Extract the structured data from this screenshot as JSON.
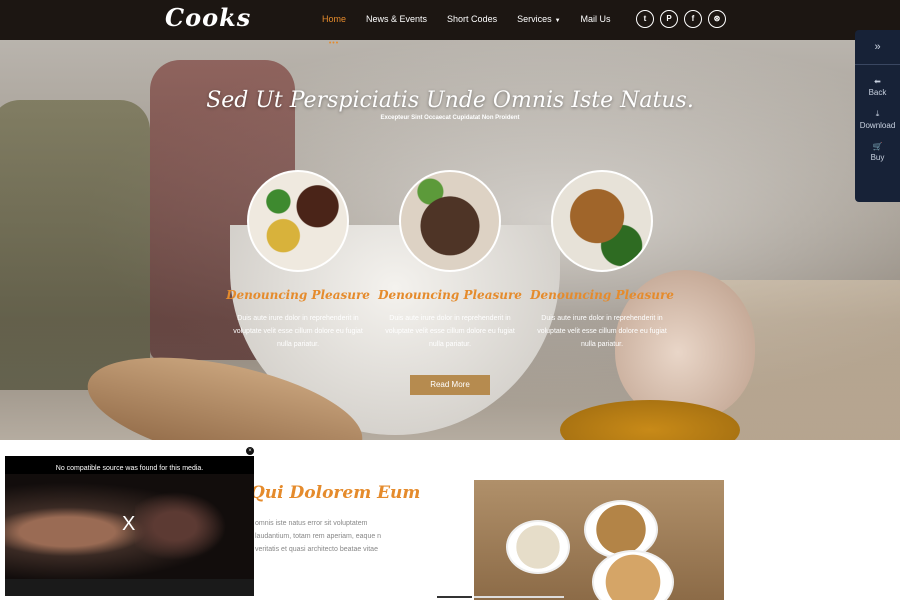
{
  "logo": "Cooks",
  "nav": {
    "items": [
      {
        "label": "Home",
        "active": true
      },
      {
        "label": "News & Events"
      },
      {
        "label": "Short Codes"
      },
      {
        "label": "Services",
        "dropdown": true
      },
      {
        "label": "Mail Us"
      }
    ],
    "active_dots": "•••"
  },
  "social": [
    {
      "icon": "twitter-icon",
      "glyph": "t"
    },
    {
      "icon": "pinterest-icon",
      "glyph": "P"
    },
    {
      "icon": "facebook-icon",
      "glyph": "f"
    },
    {
      "icon": "dribbble-icon",
      "glyph": "⊛"
    }
  ],
  "hero": {
    "title": "Sed Ut Perspiciatis Unde Omnis Iste Natus.",
    "subtitle": "Excepteur Sint Occaecat Cupidatat Non Proident",
    "features": [
      {
        "title": "Denouncing Pleasure",
        "desc": "Duis aute irure dolor in reprehenderit in voluptate velit esse cillum dolore eu fugiat nulla pariatur."
      },
      {
        "title": "Denouncing Pleasure",
        "desc": "Duis aute irure dolor in reprehenderit in voluptate velit esse cillum dolore eu fugiat nulla pariatur."
      },
      {
        "title": "Denouncing Pleasure",
        "desc": "Duis aute irure dolor in reprehenderit in voluptate velit esse cillum dolore eu fugiat nulla pariatur."
      }
    ],
    "read_more": "Read More"
  },
  "sidepanel": {
    "toggle": "»",
    "items": [
      {
        "label": "Back",
        "icon": "arrow-left-icon",
        "glyph": "⬅"
      },
      {
        "label": "Download",
        "icon": "download-icon",
        "glyph": "⤓"
      },
      {
        "label": "Buy",
        "icon": "cart-icon",
        "glyph": "🛒"
      }
    ]
  },
  "about": {
    "title": "Qui Dolorem Eum",
    "text": "omnis iste natus error sit voluptatem laudantium, totam rem aperiam, eaque n veritatis et quasi architecto beatae vitae"
  },
  "video": {
    "message": "No compatible source was found for this media.",
    "x": "X",
    "close": "×"
  },
  "colors": {
    "accent": "#e58b2c",
    "nav_bg": "#1c1612",
    "button": "#b68b4f",
    "side_panel": "#172237"
  }
}
